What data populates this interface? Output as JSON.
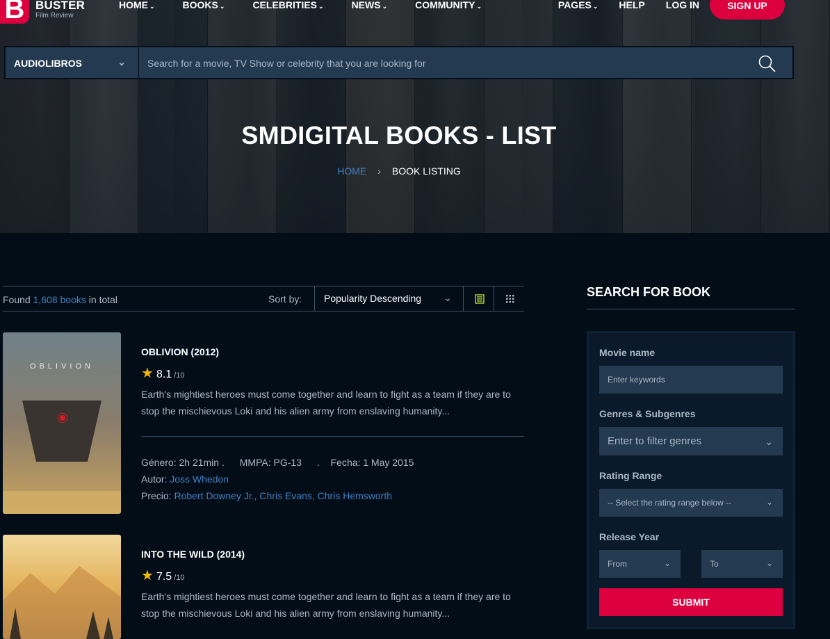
{
  "logo": {
    "letter": "B",
    "name": "BUSTER",
    "tagline": "Film Review"
  },
  "nav": {
    "left": [
      "HOME",
      "BOOKS",
      "CELEBRITIES",
      "NEWS",
      "COMMUNITY"
    ],
    "pages": "PAGES",
    "help": "HELP",
    "login": "LOG IN",
    "signup": "SIGN UP"
  },
  "search": {
    "category": "AUDIOLIBROS",
    "placeholder": "Search for a movie, TV Show or celebrity that you are looking for"
  },
  "hero": {
    "title": "SMDIGITAL BOOKS - LIST",
    "breadcrumb_home": "HOME",
    "breadcrumb_sep": "›",
    "breadcrumb_current": "BOOK LISTING"
  },
  "listing": {
    "found_prefix": "Found",
    "count": "1,608 books",
    "found_suffix": "in total",
    "sort_label": "Sort by:",
    "sort_value": "Popularity Descending"
  },
  "movies": [
    {
      "title": "OBLIVION (2012)",
      "rating": "8.1",
      "rating_max": "/10",
      "desc": "Earth's mightiest heroes must come together and learn to fight as a team if they are to stop the mischievous Loki and his alien army from enslaving humanity...",
      "genre": "Género: 2h 21min .",
      "mmpa": "MMPA: PG-13",
      "dot": ".",
      "fecha": "Fecha: 1 May 2015",
      "autor_label": "Autor:",
      "autor": "Joss Whedon",
      "precio_label": "Precio:",
      "precio": "Robert Downey Jr., Chris Evans, Chris Hemsworth",
      "poster_text": "OBLIVION"
    },
    {
      "title": "INTO THE WILD (2014)",
      "rating": "7.5",
      "rating_max": "/10",
      "desc": "Earth's mightiest heroes must come together and learn to fight as a team if they are to stop the mischievous Loki and his alien army from enslaving humanity..."
    }
  ],
  "sidebar": {
    "title": "SEARCH FOR BOOK",
    "movie_name_label": "Movie name",
    "movie_name_placeholder": "Enter keywords",
    "genres_label": "Genres & Subgenres",
    "genres_placeholder": "Enter to filter genres",
    "rating_label": "Rating Range",
    "rating_placeholder": "-- Select the rating range below --",
    "year_label": "Release Year",
    "year_from": "From",
    "year_to": "To",
    "submit": "SUBMIT"
  },
  "colors": {
    "accent": "#dd003f",
    "link": "#4280bf",
    "background": "#020d18",
    "field": "#233a50",
    "star": "#f5b50a"
  }
}
